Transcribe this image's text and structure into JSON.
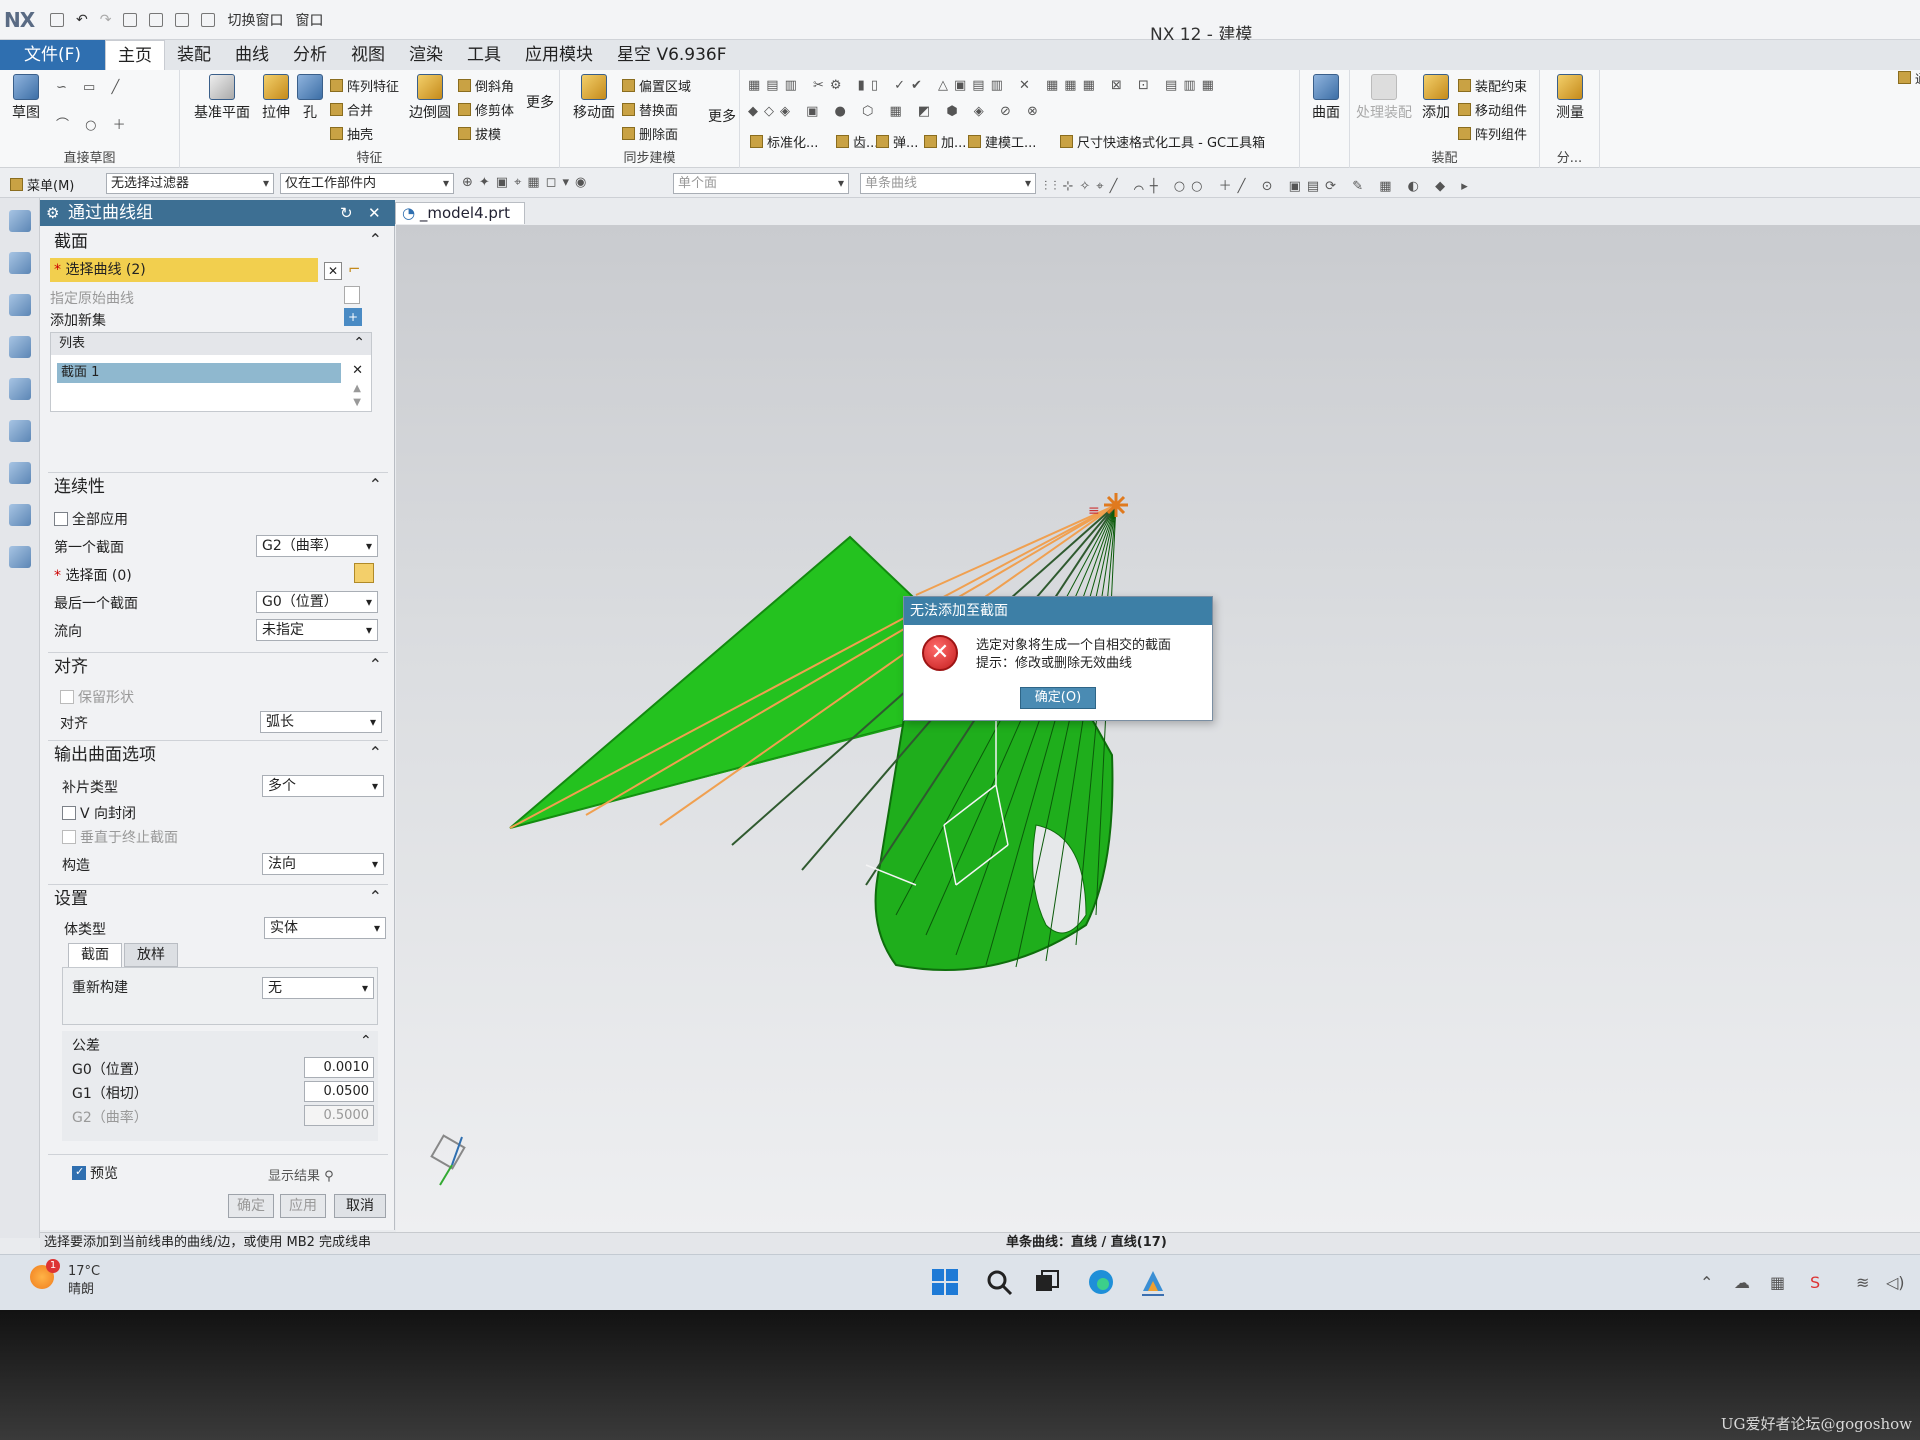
{
  "app": {
    "logo": "NX",
    "window_title": "NX 12 - 建模",
    "quick_access": [
      "切换窗口",
      "窗口"
    ]
  },
  "menu_tabs": [
    "文件(F)",
    "主页",
    "装配",
    "曲线",
    "分析",
    "视图",
    "渲染",
    "工具",
    "应用模块",
    "星空 V6.936F"
  ],
  "active_tab": "主页",
  "ribbon": {
    "sketch": {
      "btn": "草图",
      "group": "直接草图"
    },
    "feature": {
      "datum": "基准平面",
      "extrude": "拉伸",
      "hole": "孔",
      "pattern": "阵列特征",
      "unite": "合并",
      "shell": "抽壳",
      "edge_blend": "边倒圆",
      "chamfer": "倒斜角",
      "trim": "修剪体",
      "draft": "拔模",
      "more": "更多",
      "group": "特征"
    },
    "sync": {
      "move_face": "移动面",
      "offset": "偏置区域",
      "replace": "替换面",
      "delete": "删除面",
      "more": "更多",
      "group": "同步建模"
    },
    "mid_groups": [
      "标准化...",
      "齿...",
      "弹...",
      "加...",
      "建模工...",
      "尺寸快速格式化工具 - GC工具箱"
    ],
    "surface": "曲面",
    "assembly": {
      "add": "添加",
      "wave": "处理装配",
      "constraint": "装配约束",
      "move": "移动组件",
      "pattern": "阵列组件",
      "group": "装配"
    },
    "measure": "测量",
    "analysis": "分...",
    "right_edge": "通"
  },
  "filter_bar": {
    "menu": "菜单(M)",
    "type_filter": "无选择过滤器",
    "scope": "仅在工作部件内",
    "face_rule": "单个面",
    "curve_rule": "单条曲线"
  },
  "dialog": {
    "title": "通过曲线组",
    "section_header": "截面",
    "select_curve": "选择曲线 (2)",
    "specify_origin": "指定原始曲线",
    "add_new_set": "添加新集",
    "list_header": "列表",
    "list_items": [
      "截面 1"
    ],
    "continuity_header": "连续性",
    "apply_all": "全部应用",
    "first_section_label": "第一个截面",
    "first_section_value": "G2（曲率）",
    "select_face": "选择面 (0)",
    "last_section_label": "最后一个截面",
    "last_section_value": "G0（位置）",
    "flow_label": "流向",
    "flow_value": "未指定",
    "align_header": "对齐",
    "keep_shape": "保留形状",
    "align_label": "对齐",
    "align_value": "弧长",
    "output_header": "输出曲面选项",
    "patch_label": "补片类型",
    "patch_value": "多个",
    "v_closed": "V 向封闭",
    "normal_to_end": "垂直于终止截面",
    "construct_label": "构造",
    "construct_value": "法向",
    "settings_header": "设置",
    "body_type_label": "体类型",
    "body_type_value": "实体",
    "sub_tabs": [
      "截面",
      "放样"
    ],
    "rebuild_label": "重新构建",
    "rebuild_value": "无",
    "tolerance_header": "公差",
    "g0_label": "G0（位置）",
    "g0_value": "0.0010",
    "g1_label": "G1（相切）",
    "g1_value": "0.0500",
    "g2_label": "G2（曲率）",
    "g2_value": "0.5000",
    "preview": "预览",
    "show_result": "显示结果",
    "ok": "确定",
    "apply": "应用",
    "cancel": "取消"
  },
  "document_tab": "_model4.prt",
  "alert": {
    "title": "无法添加至截面",
    "line1": "选定对象将生成一个自相交的截面",
    "line2": "提示：修改或删除无效曲线",
    "ok": "确定(O)"
  },
  "status": {
    "left": "选择要添加到当前线串的曲线/边，或使用 MB2 完成线串",
    "center": "单条曲线：直线 / 直线(17)"
  },
  "taskbar": {
    "temperature": "17°C",
    "weather": "晴朗",
    "badge": "1"
  },
  "watermark": "UG爱好者论坛@gogoshow",
  "colors": {
    "surface_green": "#22c11e",
    "curve_orange": "#f0a050",
    "ruling_dark": "#2f5a2f",
    "title_blue": "#3d6f93"
  }
}
